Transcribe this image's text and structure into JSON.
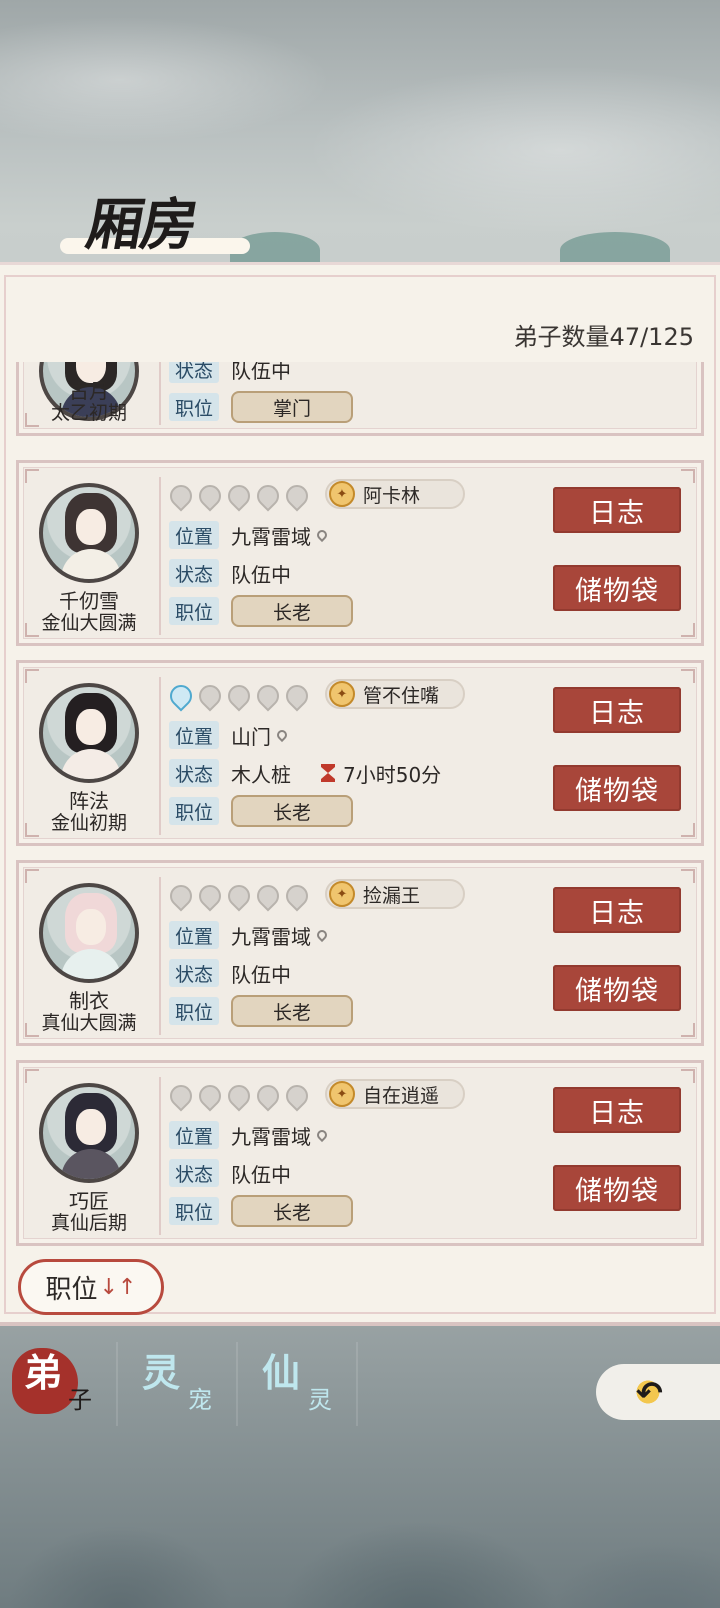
{
  "header": {
    "title": "厢房"
  },
  "panel": {
    "count_label": "弟子数量47/125",
    "sort_button": {
      "label": "职位",
      "arrows": "↓↑"
    }
  },
  "labels": {
    "location": "位置",
    "status": "状态",
    "role": "职位"
  },
  "action_buttons": {
    "log": "日志",
    "bag": "储物袋"
  },
  "disciples": [
    {
      "name": "古月",
      "realm": "太乙初期",
      "status": "队伍中",
      "role": "掌门",
      "partial": true
    },
    {
      "name": "千仞雪",
      "realm": "金仙大圆满",
      "spirit_level": 0,
      "trait": "阿卡林",
      "location": "九霄雷域",
      "status": "队伍中",
      "timer": null,
      "role": "长老"
    },
    {
      "name": "阵法",
      "realm": "金仙初期",
      "spirit_level": 1,
      "trait": "管不住嘴",
      "location": "山门",
      "status": "木人桩",
      "timer": "7小时50分",
      "role": "长老"
    },
    {
      "name": "制衣",
      "realm": "真仙大圆满",
      "spirit_level": 0,
      "trait": "捡漏王",
      "location": "九霄雷域",
      "status": "队伍中",
      "timer": null,
      "role": "长老"
    },
    {
      "name": "巧匠",
      "realm": "真仙后期",
      "spirit_level": 0,
      "trait": "自在逍遥",
      "location": "九霄雷域",
      "status": "队伍中",
      "timer": null,
      "role": "长老"
    }
  ],
  "tabs": [
    {
      "big": "弟",
      "small": "子",
      "active": true
    },
    {
      "big": "灵",
      "small": "宠",
      "active": false
    },
    {
      "big": "仙",
      "small": "灵",
      "active": false
    }
  ],
  "icons": {
    "trait_badge": "trait-badge-icon",
    "back": "back-arrow-icon",
    "location": "map-pin-icon",
    "timer": "hourglass-icon",
    "spirit": "spirit-drop-icon"
  },
  "colors": {
    "action_button": "#a8463a",
    "tag_bg": "#d5e4ea",
    "active_tab_seal": "#a5312b"
  }
}
